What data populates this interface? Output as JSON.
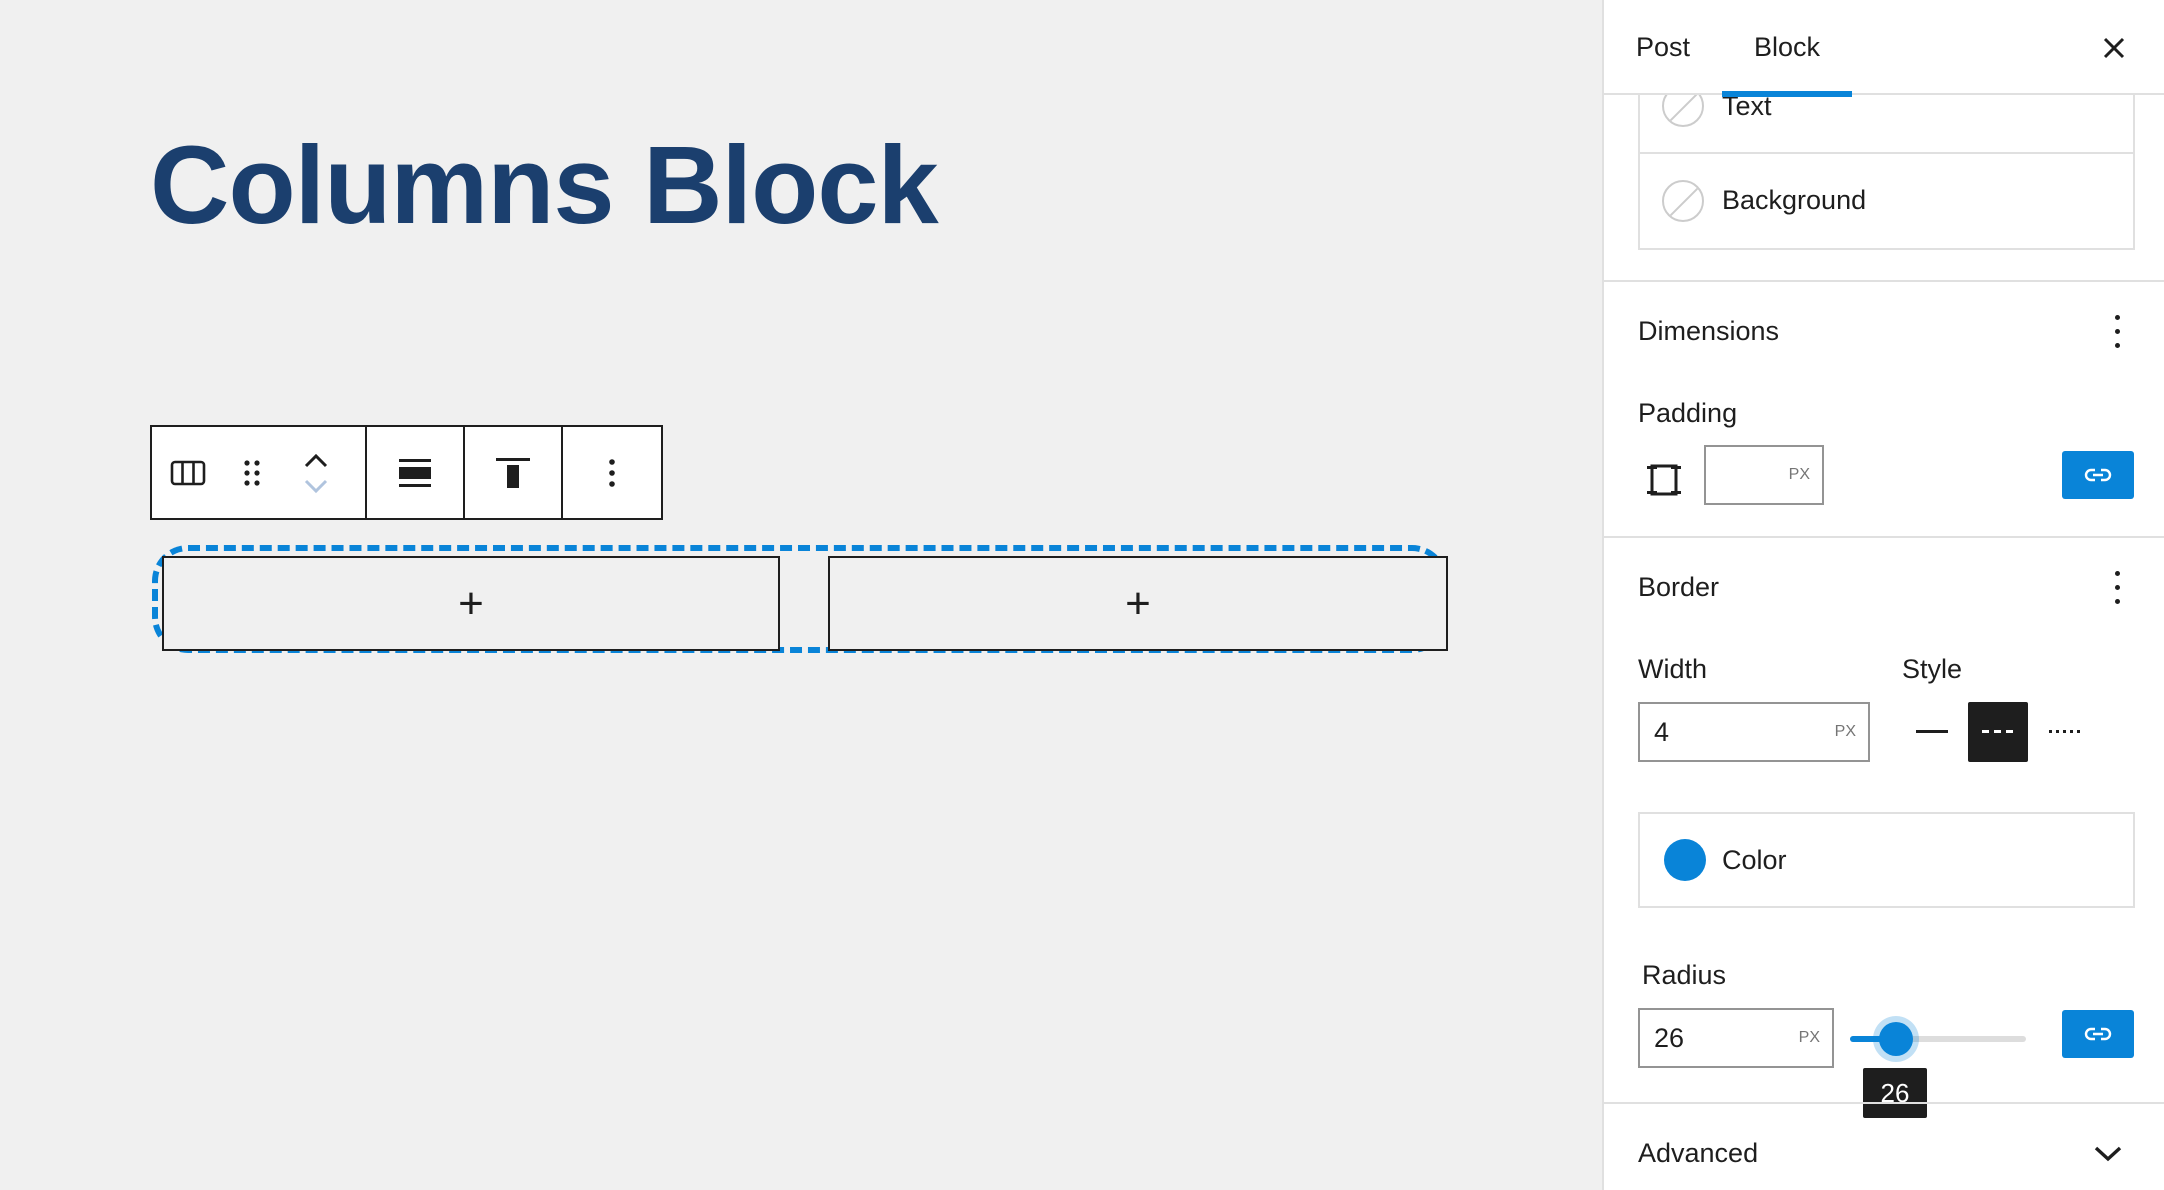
{
  "canvas": {
    "title": "Columns Block",
    "columns": [
      {
        "add_label": "+"
      },
      {
        "add_label": "+"
      }
    ]
  },
  "toolbar": {
    "icons": [
      "columns-icon",
      "drag-handle-icon",
      "move-up-icon",
      "move-down-icon",
      "align-wide-icon",
      "vertical-align-top-icon",
      "more-options-icon"
    ]
  },
  "sidebar": {
    "tabs": [
      "Post",
      "Block"
    ],
    "active_tab": "Block",
    "color": {
      "items": [
        "Text",
        "Background"
      ]
    },
    "dimensions": {
      "title": "Dimensions",
      "padding_label": "Padding",
      "padding_value": "",
      "padding_unit": "PX"
    },
    "border": {
      "title": "Border",
      "width_label": "Width",
      "width_value": "4",
      "width_unit": "PX",
      "style_label": "Style",
      "style_selected": "dashed",
      "color_label": "Color",
      "color_value": "#0984d8",
      "radius_label": "Radius",
      "radius_value": "26",
      "radius_unit": "PX",
      "radius_tooltip": "26",
      "radius_slider_fraction": 0.26
    },
    "advanced": {
      "title": "Advanced"
    }
  },
  "colors": {
    "accent": "#0984d8",
    "title": "#1b3f6e",
    "text": "#1e1e1e"
  }
}
